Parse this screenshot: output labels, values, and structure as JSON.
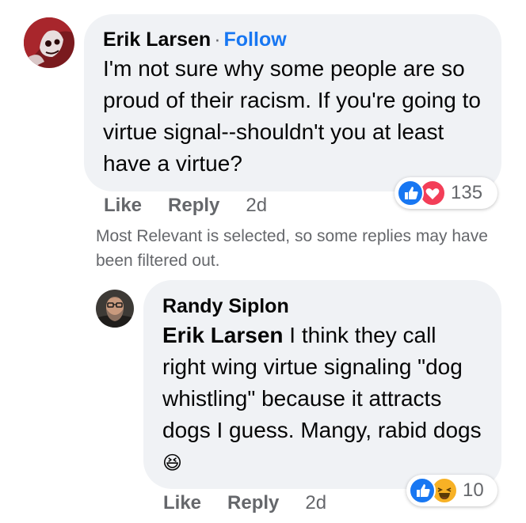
{
  "comment": {
    "author": "Erik Larsen",
    "separator": "·",
    "follow_label": "Follow",
    "text": "I'm not sure why some people are so proud of their racism. If you're going to virtue signal--shouldn't you at least have a virtue?",
    "like_label": "Like",
    "reply_label": "Reply",
    "timestamp": "2d",
    "reactions": {
      "icons": [
        "like-icon",
        "love-icon"
      ],
      "count": "135"
    }
  },
  "filter_notice": "Most Relevant is selected, so some replies may have been filtered out.",
  "reply": {
    "author": "Randy Siplon",
    "mention": "Erik Larsen",
    "text": " I think they call right wing virtue signaling \"dog whistling\" because it attracts dogs I guess. Mangy, rabid dogs",
    "emoji": "😆",
    "like_label": "Like",
    "reply_label": "Reply",
    "timestamp": "2d",
    "reactions": {
      "icons": [
        "like-icon",
        "haha-icon"
      ],
      "count": "10"
    }
  },
  "colors": {
    "bubble": "#f0f2f5",
    "link": "#1877f2",
    "meta": "#65676b",
    "like": "#1877f2",
    "love": "#f33e58",
    "haha": "#f7b125"
  }
}
